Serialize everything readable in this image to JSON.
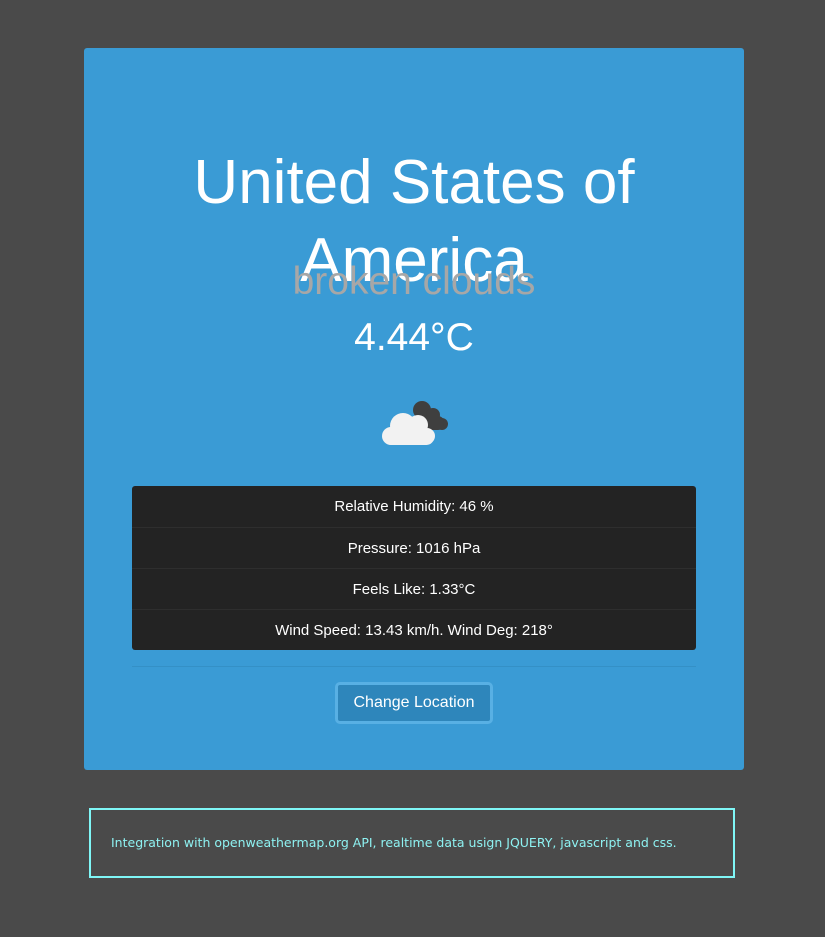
{
  "weather": {
    "location": "United States of America",
    "description": "broken clouds",
    "temperature": "4.44°C",
    "icon": "broken-clouds-icon"
  },
  "stats": [
    {
      "text": "Relative Humidity: 46 %"
    },
    {
      "text": "Pressure: 1016 hPa"
    },
    {
      "text": "Feels Like: 1.33°C"
    },
    {
      "text": "Wind Speed: 13.43 km/h. Wind Deg: 218°"
    }
  ],
  "actions": {
    "change_location_label": "Change Location"
  },
  "footer": {
    "text": "Integration with openweathermap.org API, realtime data usign JQUERY, javascript and css."
  },
  "colors": {
    "page_background": "#4a4a4a",
    "card_background": "#3a9bd5",
    "table_background": "#232323",
    "button_background": "#2e86bb",
    "footer_accent": "#7ff6f6"
  }
}
